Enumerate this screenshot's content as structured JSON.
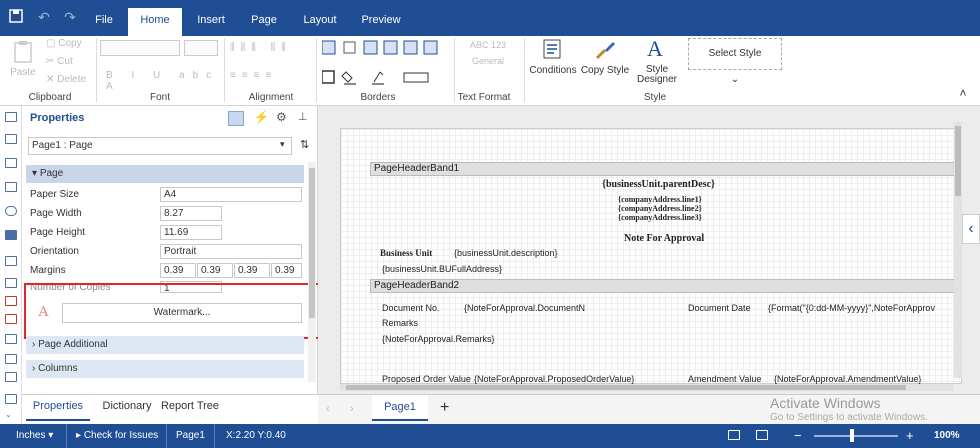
{
  "tabs": [
    "File",
    "Home",
    "Insert",
    "Page",
    "Layout",
    "Preview"
  ],
  "ribbon": {
    "clipboard": {
      "paste": "Paste",
      "copy": "Copy",
      "cut": "Cut",
      "delete": "Delete",
      "label": "Clipboard"
    },
    "font": {
      "label": "Font"
    },
    "alignment": {
      "label": "Alignment"
    },
    "borders": {
      "label": "Borders"
    },
    "text_format": {
      "preview": "ABC 123",
      "general": "General",
      "label": "Text Format"
    },
    "style": {
      "conditions": "Conditions",
      "copy_style": "Copy Style",
      "style_designer": "Style Designer",
      "select_style": "Select Style",
      "label": "Style"
    }
  },
  "properties": {
    "title": "Properties",
    "selector": "Page1 : Page",
    "section_page": "Page",
    "rows": [
      {
        "label": "Paper Size",
        "value": "A4"
      },
      {
        "label": "Page Width",
        "value": "8.27"
      },
      {
        "label": "Page Height",
        "value": "11.69"
      },
      {
        "label": "Orientation",
        "value": "Portrait"
      },
      {
        "label": "Margins",
        "value": "0.39"
      },
      {
        "label": "Number of Copies",
        "value": "1"
      }
    ],
    "margins": [
      "0.39",
      "0.39",
      "0.39",
      "0.39"
    ],
    "watermark": "Watermark...",
    "section_additional": "Page Additional",
    "section_columns": "Columns",
    "bottom_tabs": [
      "Properties",
      "Dictionary",
      "Report Tree"
    ]
  },
  "designer": {
    "band1": "PageHeaderBand1",
    "parent_desc": "{businessUnit.parentDesc}",
    "addr1": "{companyAddress.line1}",
    "addr2": "{companyAddress.line2}",
    "addr3": "{companyAddress.line3}",
    "note_title": "Note For Approval",
    "business_unit_label": "Business Unit",
    "business_unit_value": "{businessUnit.description}",
    "bu_full_address": "{businessUnit.BUFullAddress}",
    "band2": "PageHeaderBand2",
    "doc_no_label": "Document No.",
    "doc_no_value": "{NoteForApproval.DocumentN",
    "doc_date_label": "Document Date",
    "doc_date_value": "{Format(\"{0:dd-MM-yyyy}\",NoteForApprov",
    "remarks_label": "Remarks",
    "remarks_value": "{NoteForApproval.Remarks}",
    "proposed_label": "Proposed Order Value",
    "proposed_value": "{NoteForApproval.ProposedOrderValue}",
    "amendment_label": "Amendment Value",
    "amendment_value": "{NoteForApproval.AmendmentValue}",
    "page_tab": "Page1",
    "activate_title": "Activate Windows",
    "activate_sub": "Go to Settings to activate Windows."
  },
  "status": {
    "units": "Inches",
    "check": "Check for Issues",
    "page": "Page1",
    "coords": "X:2.20 Y:0.40",
    "zoom": "100%"
  },
  "colors": {
    "brand": "#1f4e95",
    "highlight": "#e0262c"
  }
}
